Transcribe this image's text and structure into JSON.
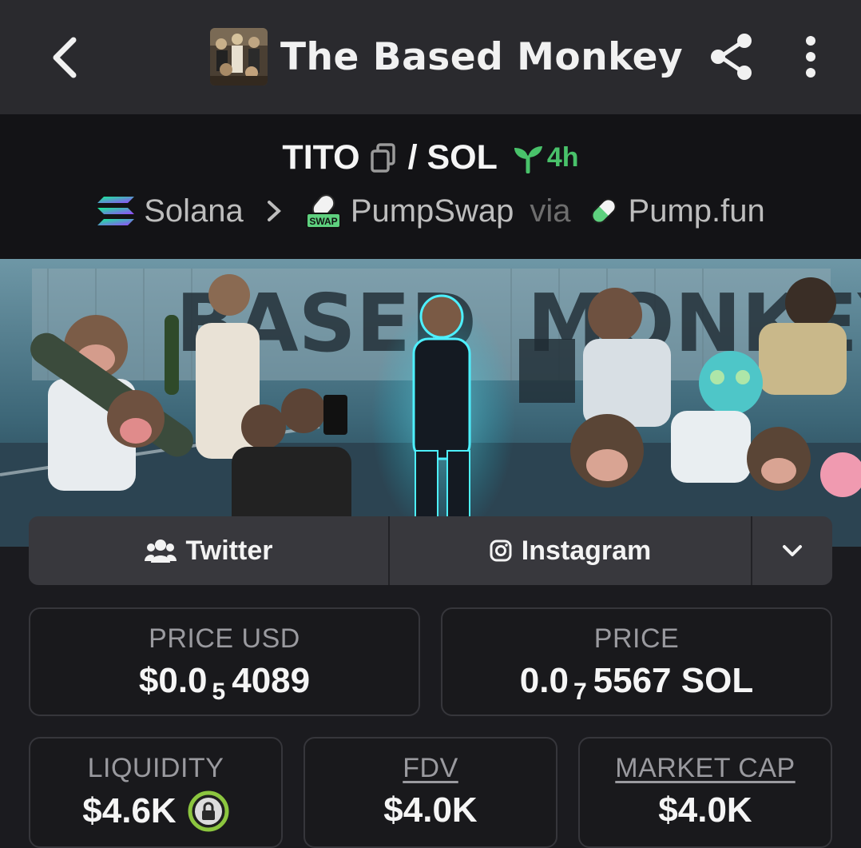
{
  "header": {
    "title": "The Based Monkey"
  },
  "pair": {
    "base": "TITO",
    "quote": "/ SOL",
    "age": "4h",
    "chain": "Solana",
    "dex": "PumpSwap",
    "via": "via",
    "launchpad": "Pump.fun",
    "swap_badge": "SWAP"
  },
  "banner": {
    "text_left": "BASED",
    "text_right": "MONKEY"
  },
  "socials": {
    "twitter": "Twitter",
    "instagram": "Instagram"
  },
  "stats": {
    "price_usd_label": "PRICE USD",
    "price_usd_prefix": "$0.0",
    "price_usd_zeros": "5",
    "price_usd_digits": "4089",
    "price_label": "PRICE",
    "price_prefix": "0.0",
    "price_zeros": "7",
    "price_digits": "5567 SOL",
    "liquidity_label": "LIQUIDITY",
    "liquidity_value": "$4.6K",
    "fdv_label": "FDV",
    "fdv_value": "$4.0K",
    "mcap_label": "MARKET CAP",
    "mcap_value": "$4.0K"
  },
  "colors": {
    "accent_green": "#49c26a",
    "lock_ring": "#8cc63f",
    "background": "#1b1b1f"
  },
  "icons": [
    "back-icon",
    "share-icon",
    "more-icon",
    "copy-icon",
    "sprout-icon",
    "solana-icon",
    "pumpswap-icon",
    "pill-icon",
    "users-icon",
    "instagram-icon",
    "chevron-down-icon",
    "lock-icon"
  ]
}
